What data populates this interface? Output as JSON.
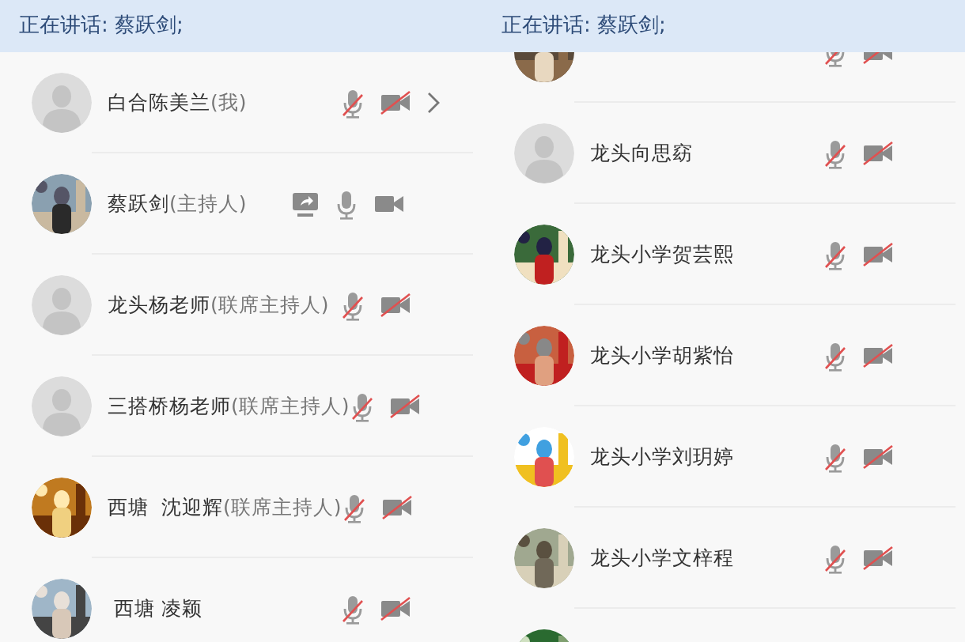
{
  "panels": [
    {
      "speaking_banner": "正在讲话: 蔡跃剑;",
      "participants": [
        {
          "kind": "full",
          "avatar": {
            "kind": "default"
          },
          "name": "白合陈美兰",
          "role": "(我)",
          "sharing": false,
          "mic_on": false,
          "camera_on": false,
          "chevron": true
        },
        {
          "kind": "full",
          "name": "蔡跃剑",
          "role": "(主持人)",
          "sharing": true,
          "mic_on": true,
          "camera_on": true,
          "chevron": false
        },
        {
          "kind": "full",
          "avatar": {
            "kind": "default"
          },
          "name": "龙头杨老师",
          "role": "(联席主持人)",
          "sharing": false,
          "mic_on": false,
          "camera_on": false,
          "chevron": false
        },
        {
          "kind": "full",
          "avatar": {
            "kind": "default"
          },
          "name": "三搭桥杨老师",
          "role": "(联席主持人)",
          "sharing": false,
          "mic_on": false,
          "camera_on": false,
          "chevron": false
        },
        {
          "kind": "full",
          "name": "西塘  沈迎辉",
          "role": "(联席主持人)",
          "sharing": false,
          "mic_on": false,
          "camera_on": false,
          "chevron": false
        },
        {
          "kind": "full",
          "name": " 西塘 凌颖",
          "sharing": false,
          "mic_on": false,
          "camera_on": false,
          "chevron": false
        }
      ]
    },
    {
      "speaking_banner": "正在讲话: 蔡跃剑;",
      "participants": [
        {
          "kind": "cut_top",
          "mic_on": false,
          "camera_on": false
        },
        {
          "kind": "full",
          "avatar": {
            "kind": "default"
          },
          "name": "龙头向思窈",
          "sharing": false,
          "mic_on": false,
          "camera_on": false,
          "chevron": false
        },
        {
          "kind": "full",
          "name": "龙头小学贺芸熙",
          "sharing": false,
          "mic_on": false,
          "camera_on": false,
          "chevron": false
        },
        {
          "kind": "full",
          "name": "龙头小学胡紫怡",
          "sharing": false,
          "mic_on": false,
          "camera_on": false,
          "chevron": false
        },
        {
          "kind": "full",
          "name": "龙头小学刘玥婷",
          "sharing": false,
          "mic_on": false,
          "camera_on": false,
          "chevron": false
        },
        {
          "kind": "full",
          "name": "龙头小学文梓程",
          "sharing": false,
          "mic_on": false,
          "camera_on": false,
          "chevron": false
        },
        {
          "kind": "cut_bottom"
        }
      ]
    }
  ]
}
